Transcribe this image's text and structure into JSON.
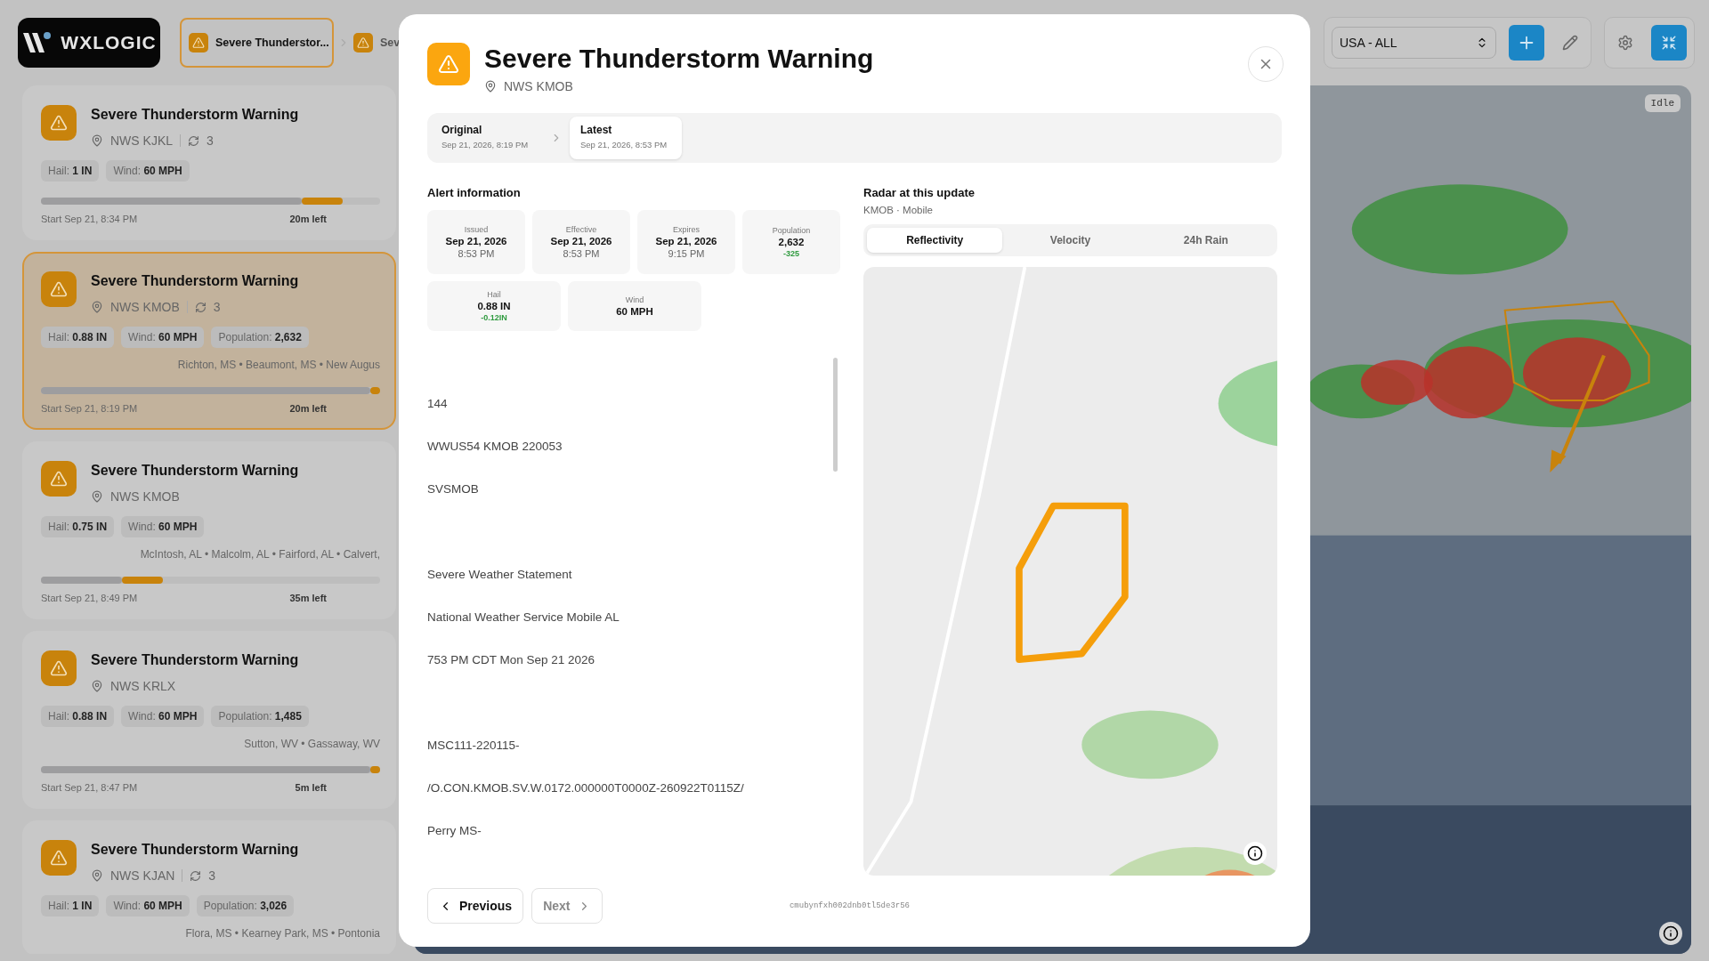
{
  "app": {
    "logo": "WXLOGIC"
  },
  "breadcrumbs": [
    {
      "label": "Severe Thunderstor...",
      "selected": true
    },
    {
      "label": "Sev",
      "selected": false
    }
  ],
  "toolbar": {
    "region_select": "USA - ALL"
  },
  "alerts": [
    {
      "title": "Severe Thunderstorm Warning",
      "office": "NWS KJKL",
      "updates": "3",
      "chips": [
        {
          "label": "Hail:",
          "value": "1 IN"
        },
        {
          "label": "Wind:",
          "value": "60 MPH"
        }
      ],
      "start": "Start Sep 21, 8:34 PM",
      "remaining": "20m left",
      "level": 0.77,
      "selected": false
    },
    {
      "title": "Severe Thunderstorm Warning",
      "office": "NWS KMOB",
      "updates": "3",
      "chips": [
        {
          "label": "Hail:",
          "value": "0.88 IN"
        },
        {
          "label": "Wind:",
          "value": "60 MPH"
        },
        {
          "label": "Population:",
          "value": "2,632"
        }
      ],
      "places": "Richton, MS • Beaumont, MS • New Augus",
      "start": "Start Sep 21, 8:19 PM",
      "remaining": "20m left",
      "level": 0.97,
      "selected": true
    },
    {
      "title": "Severe Thunderstorm Warning",
      "office": "NWS KMOB",
      "chips": [
        {
          "label": "Hail:",
          "value": "0.75 IN"
        },
        {
          "label": "Wind:",
          "value": "60 MPH"
        }
      ],
      "places": "McIntosh, AL • Malcolm, AL • Fairford, AL • Calvert,",
      "start": "Start Sep 21, 8:49 PM",
      "remaining": "35m left",
      "level": 0.24,
      "selected": false
    },
    {
      "title": "Severe Thunderstorm Warning",
      "office": "NWS KRLX",
      "chips": [
        {
          "label": "Hail:",
          "value": "0.88 IN"
        },
        {
          "label": "Wind:",
          "value": "60 MPH"
        },
        {
          "label": "Population:",
          "value": "1,485"
        }
      ],
      "places": "Sutton, WV • Gassaway, WV",
      "start": "Start Sep 21, 8:47 PM",
      "remaining": "5m left",
      "level": 0.97,
      "selected": false
    },
    {
      "title": "Severe Thunderstorm Warning",
      "office": "NWS KJAN",
      "updates": "3",
      "chips": [
        {
          "label": "Hail:",
          "value": "1 IN"
        },
        {
          "label": "Wind:",
          "value": "60 MPH"
        },
        {
          "label": "Population:",
          "value": "3,026"
        }
      ],
      "places": "Flora, MS • Kearney Park, MS • Pontonia",
      "selected": false
    }
  ],
  "map": {
    "status": "Idle"
  },
  "modal": {
    "title": "Severe Thunderstorm Warning",
    "office": "NWS KMOB",
    "versions": [
      {
        "label": "Original",
        "time": "Sep 21, 2026, 8:19 PM",
        "selected": false
      },
      {
        "label": "Latest",
        "time": "Sep 21, 2026, 8:53 PM",
        "selected": true
      }
    ],
    "alert_heading": "Alert information",
    "stats": [
      {
        "label": "Issued",
        "value": "Sep 21, 2026",
        "sub": "8:53 PM"
      },
      {
        "label": "Effective",
        "value": "Sep 21, 2026",
        "sub": "8:53 PM"
      },
      {
        "label": "Expires",
        "value": "Sep 21, 2026",
        "sub": "9:15 PM"
      },
      {
        "label": "Population",
        "value": "2,632",
        "delta": "-325"
      }
    ],
    "measures": [
      {
        "label": "Hail",
        "value": "0.88 IN",
        "delta": "-0.12IN"
      },
      {
        "label": "Wind",
        "value": "60 MPH"
      }
    ],
    "text_blocks": [
      [
        "144",
        "WWUS54 KMOB 220053",
        "SVSMOB"
      ],
      [
        "Severe Weather Statement",
        "National Weather Service Mobile AL",
        "753 PM CDT Mon Sep 21 2026"
      ],
      [
        "MSC111-220115-",
        "/O.CON.KMOB.SV.W.0172.000000T0000Z-260922T0115Z/",
        "Perry MS-"
      ]
    ],
    "radar_heading": "Radar at this update",
    "radar_source": "KMOB · Mobile",
    "radar_tabs": [
      {
        "label": "Reflectivity",
        "selected": true
      },
      {
        "label": "Velocity",
        "selected": false
      },
      {
        "label": "24h Rain",
        "selected": false
      }
    ],
    "previous": {
      "label": "Previous",
      "disabled": false
    },
    "next": {
      "label": "Next",
      "disabled": true
    },
    "record_id": "cmubynfxh002dnb0tl5de3r56"
  }
}
